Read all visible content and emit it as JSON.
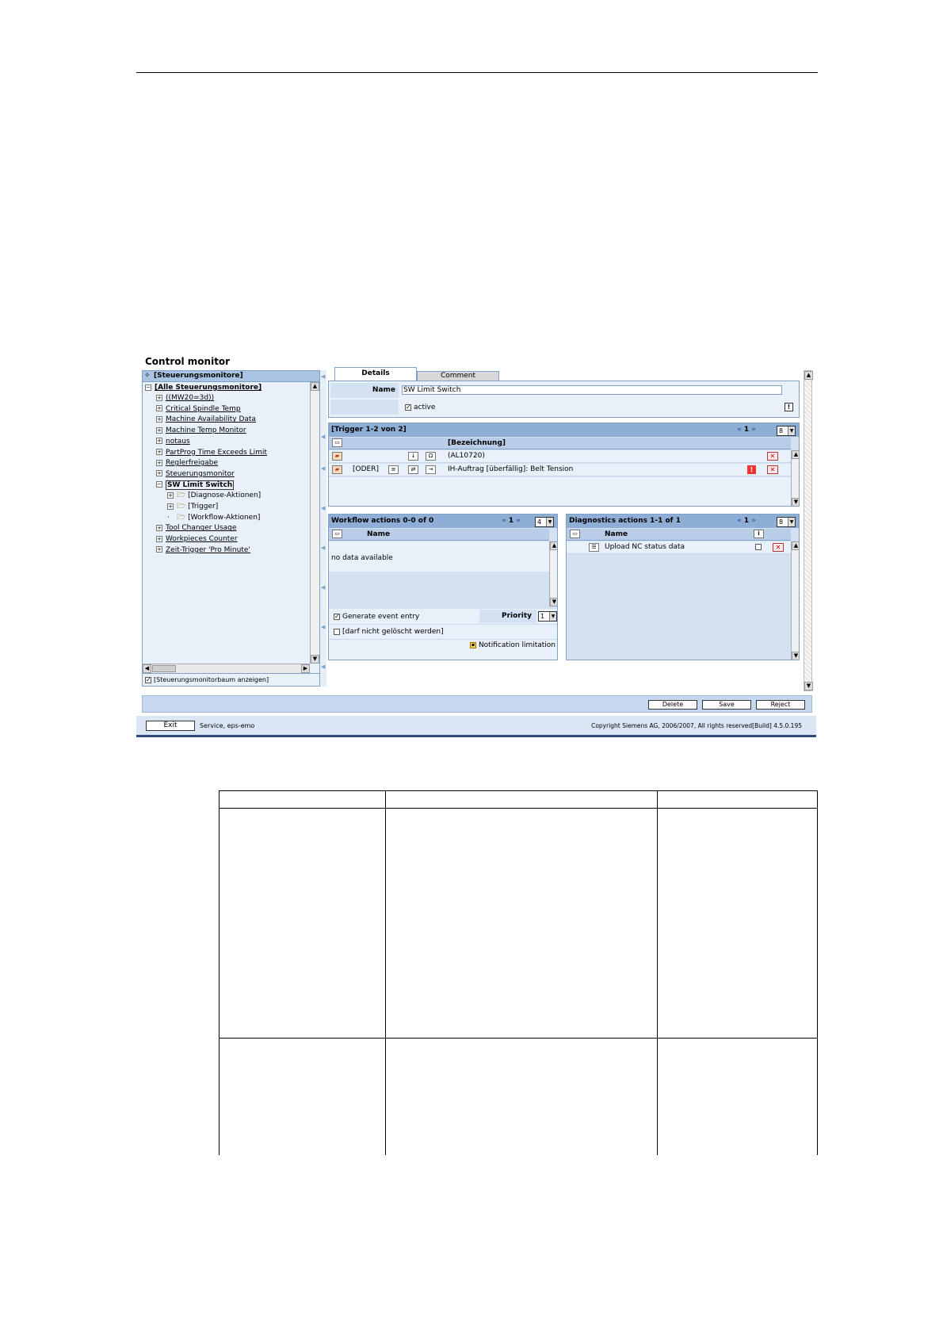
{
  "app": {
    "title": "Control monitor"
  },
  "tree": {
    "root_label": "[Steuerungsmonitore]",
    "all_label": "[Alle Steuerungsmonitore]",
    "items": [
      {
        "label": "((MW20=3d))",
        "level": 1,
        "expander": "+"
      },
      {
        "label": "Critical Spindle Temp",
        "level": 1,
        "expander": "+"
      },
      {
        "label": "Machine Availability Data",
        "level": 1,
        "expander": "+"
      },
      {
        "label": "Machine Temp Monitor",
        "level": 1,
        "expander": "+"
      },
      {
        "label": "notaus",
        "level": 1,
        "expander": "+"
      },
      {
        "label": "PartProg Time Exceeds Limit",
        "level": 1,
        "expander": "+"
      },
      {
        "label": "Reglerfreigabe",
        "level": 1,
        "expander": "+"
      },
      {
        "label": "Steuerungsmonitor",
        "level": 1,
        "expander": "+"
      },
      {
        "label": "SW Limit Switch",
        "level": 1,
        "expander": "-",
        "selected": true
      },
      {
        "label": "[Diagnose-Aktionen]",
        "level": 2,
        "expander": "+",
        "folder": true
      },
      {
        "label": "[Trigger]",
        "level": 2,
        "expander": "+",
        "folder": true
      },
      {
        "label": "[Workflow-Aktionen]",
        "level": 2,
        "expander": "",
        "folder": true
      },
      {
        "label": "Tool Changer Usage",
        "level": 1,
        "expander": "+"
      },
      {
        "label": "Workpieces Counter",
        "level": 1,
        "expander": "+"
      },
      {
        "label": "Zeit-Trigger 'Pro Minute'",
        "level": 1,
        "expander": "+"
      }
    ],
    "footer_checkbox_label": "[Steuerungsmonitorbaum anzeigen]"
  },
  "tabs": {
    "details": "Details",
    "comment": "Comment"
  },
  "details": {
    "name_label": "Name",
    "name_value": "SW Limit Switch",
    "active_label": "active"
  },
  "trigger": {
    "header": "[Trigger 1-2 von 2]",
    "page": "1",
    "page_size": "8",
    "col_bezeichnung": "[Bezeichnung]",
    "rows": [
      {
        "operator": "",
        "label": "(AL10720)"
      },
      {
        "operator": "[ODER]",
        "label": "IH-Auftrag [überfällig]: Belt Tension"
      }
    ]
  },
  "workflow": {
    "header": "Workflow actions 0-0 of 0",
    "page": "1",
    "page_size": "4",
    "col_name": "Name",
    "empty_text": "no data available",
    "generate_label": "Generate event entry",
    "priority_label": "Priority",
    "priority_value": "1",
    "nodelete_label": "[darf nicht gelöscht werden]",
    "notification_label": "Notification limitation"
  },
  "diagnostics": {
    "header": "Diagnostics actions 1-1 of 1",
    "page": "1",
    "page_size": "8",
    "col_name": "Name",
    "rows": [
      {
        "label": "Upload NC status data"
      }
    ]
  },
  "buttons": {
    "delete": "Delete",
    "save": "Save",
    "reject": "Reject",
    "exit": "Exit"
  },
  "status": {
    "user": "Service, eps-emo",
    "copyright": "Copyright Siemens AG, 2006/2007, All rights reserved[Build] 4.5.0.195"
  }
}
